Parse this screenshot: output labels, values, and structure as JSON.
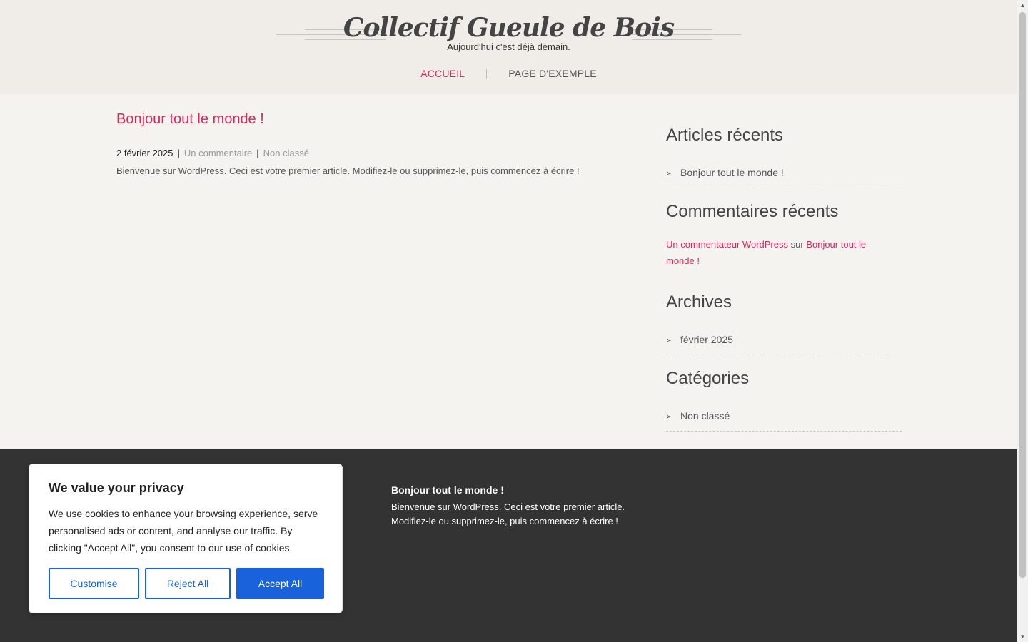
{
  "header": {
    "site_title": "Collectif Gueule de Bois",
    "tagline": "Aujourd'hui c'est déjà demain.",
    "nav": [
      {
        "label": "ACCUEIL",
        "active": true
      },
      {
        "label": "PAGE D'EXEMPLE",
        "active": false
      }
    ]
  },
  "post": {
    "title": "Bonjour tout le monde !",
    "date": "2 février 2025",
    "comments": "Un commentaire",
    "category": "Non classé",
    "excerpt": "Bienvenue sur WordPress. Ceci est votre premier article. Modifiez-le ou supprimez-le, puis commencez à écrire !"
  },
  "sidebar": {
    "recent_posts_title": "Articles récents",
    "recent_posts": [
      "Bonjour tout le monde !"
    ],
    "recent_comments_title": "Commentaires récents",
    "recent_comment": {
      "author": "Un commentateur WordPress",
      "connector": "sur",
      "post": "Bonjour tout le monde !"
    },
    "archives_title": "Archives",
    "archives": [
      "février 2025"
    ],
    "categories_title": "Catégories",
    "categories": [
      "Non classé"
    ]
  },
  "footer": {
    "post_title": "Bonjour tout le monde !",
    "post_text": "Bienvenue sur WordPress. Ceci est votre premier article. Modifiez-le ou supprimez-le, puis commencez à écrire !"
  },
  "cookie": {
    "title": "We value your privacy",
    "text": "We use cookies to enhance your browsing experience, serve personalised ads or content, and analyse our traffic. By clicking \"Accept All\", you consent to our use of cookies.",
    "customise_label": "Customise",
    "reject_label": "Reject All",
    "accept_label": "Accept All"
  },
  "colors": {
    "accent": "#d6295b",
    "header_bg": "#f0ede8",
    "page_bg": "#f5f3ef",
    "footer_bg": "#333333",
    "button_blue": "#1863dc"
  },
  "icons": {
    "list_bullet": "chevron-bullet-icon",
    "scroll_up": "scroll-up-arrow-icon",
    "scroll_down": "scroll-down-arrow-icon"
  }
}
